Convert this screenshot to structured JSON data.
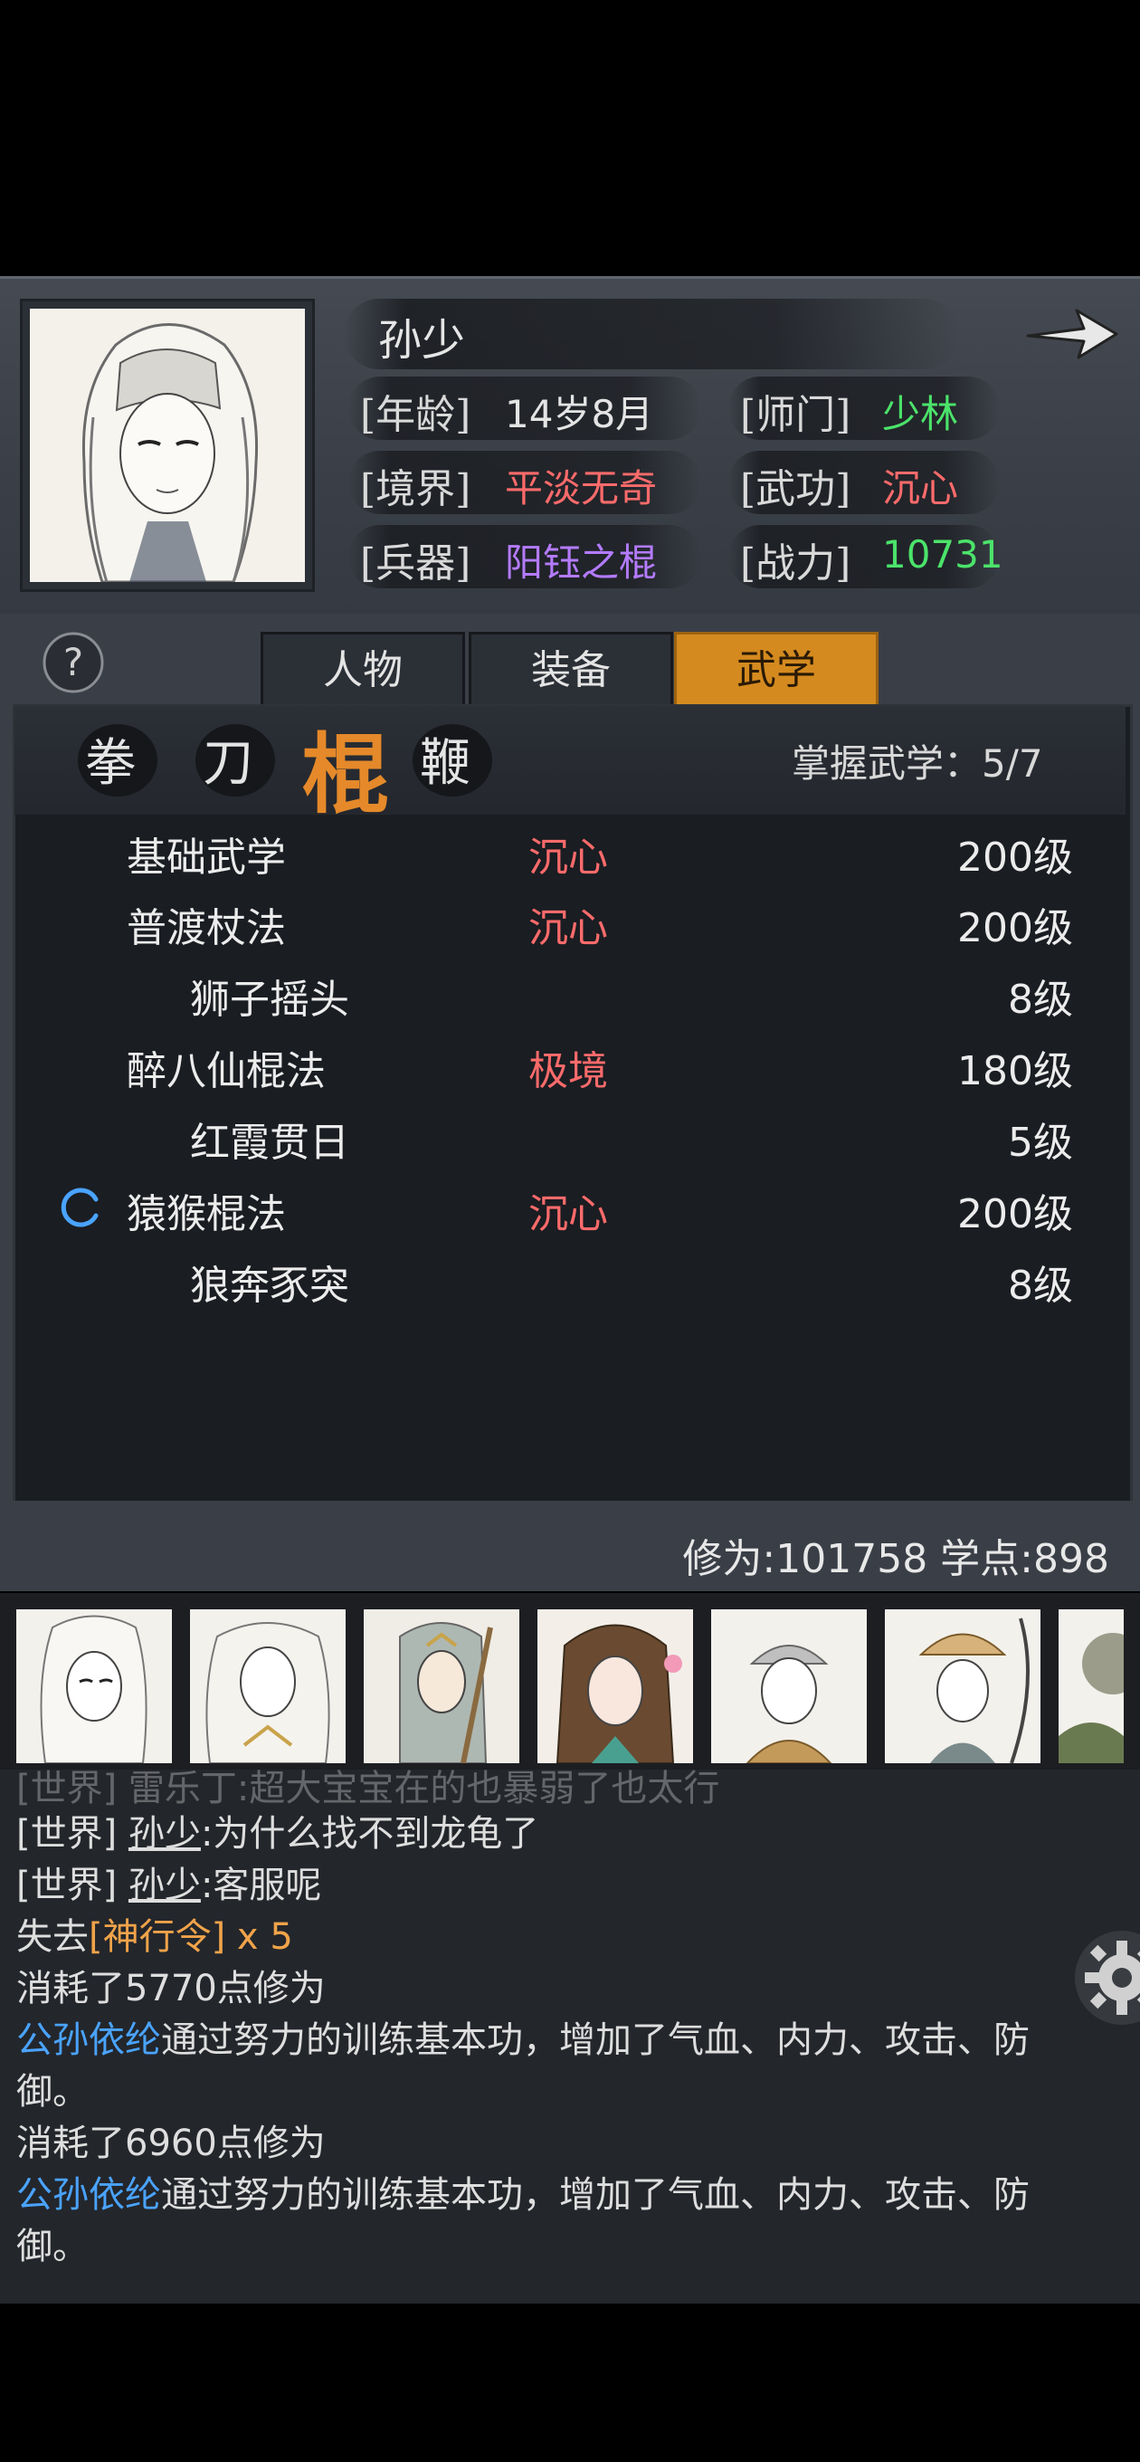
{
  "character": {
    "name": "孙少",
    "rows": [
      {
        "label": "[年龄]",
        "value": "14岁8月",
        "label2": "[师门]",
        "value2": "少林"
      },
      {
        "label": "[境界]",
        "value": "平淡无奇",
        "label2": "[武功]",
        "value2": "沉心"
      },
      {
        "label": "[兵器]",
        "value": "阳钰之棍",
        "label2": "[战力]",
        "value2": "10731"
      }
    ]
  },
  "tabs": [
    "人物",
    "装备",
    "武学"
  ],
  "active_tab": "武学",
  "categories": [
    "拳",
    "刀",
    "棍",
    "鞭"
  ],
  "active_category": "棍",
  "mastery": "掌握武学：5/7",
  "kungfu_list": [
    {
      "name": "基础武学",
      "state": "沉心",
      "level": "200级"
    },
    {
      "name": "普渡杖法",
      "state": "沉心",
      "level": "200级"
    },
    {
      "name": "狮子摇头",
      "state": "",
      "level": "8级"
    },
    {
      "name": "醉八仙棍法",
      "state": "极境",
      "level": "180级"
    },
    {
      "name": "红霞贯日",
      "state": "",
      "level": "5级"
    },
    {
      "name": "猿猴棍法",
      "state": "沉心",
      "level": "200级"
    },
    {
      "name": "狼奔豕突",
      "state": "",
      "level": "8级"
    }
  ],
  "cultivation": "修为:101758 学点:898",
  "chat": {
    "partial_line": "[世界] 雷乐丁:超大宝宝在的也暴弱了也太行",
    "line1_tag": "[世界]",
    "line1_user": "孙少",
    "line1_text": ":为什么找不到龙龟了",
    "line2_tag": "[世界]",
    "line2_user": "孙少",
    "line2_text": ":客服呢",
    "line3_pre": "失去",
    "line3_item": "[神行令]",
    "line3_count": " x 5",
    "line4": "消耗了5770点修为",
    "line5_name": "公孙依纶",
    "line5_text": "通过努力的训练基本功，增加了气血、内力、攻击、防",
    "line5_cont": "御。",
    "line6": "消耗了6960点修为",
    "line7_name": "公孙依纶",
    "line7_text": "通过努力的训练基本功，增加了气血、内力、攻击、防",
    "line7_cont": "御。"
  },
  "colors": {
    "green": "#4be36a",
    "red": "#ff6b6b",
    "purple": "#b47bff",
    "orange": "#d48a1f",
    "blue": "#4aa3ff"
  }
}
